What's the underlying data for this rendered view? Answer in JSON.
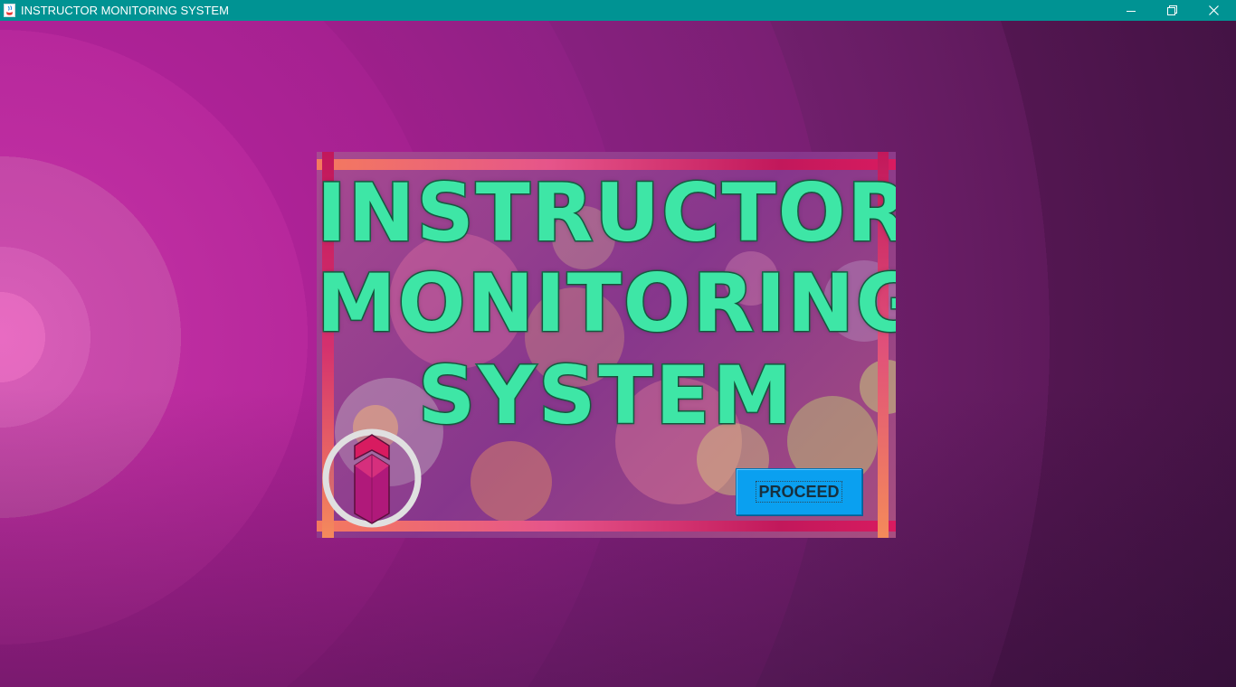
{
  "window": {
    "title": "INSTRUCTOR MONITORING SYSTEM",
    "controls": {
      "minimize": "minimize-icon",
      "maximize": "restore-icon",
      "close": "close-icon"
    }
  },
  "splash": {
    "headline": [
      "INSTRUCTOR",
      "MONITORING",
      "SYSTEM"
    ],
    "proceed_label": "PROCEED",
    "logo_icon": "i-monogram-logo"
  },
  "colors": {
    "titlebar": "#009393",
    "headline_fill": "#3ee6a6",
    "headline_outline": "#1f6b4e",
    "button": "#0aa0f0",
    "frame": "#c2185b"
  }
}
